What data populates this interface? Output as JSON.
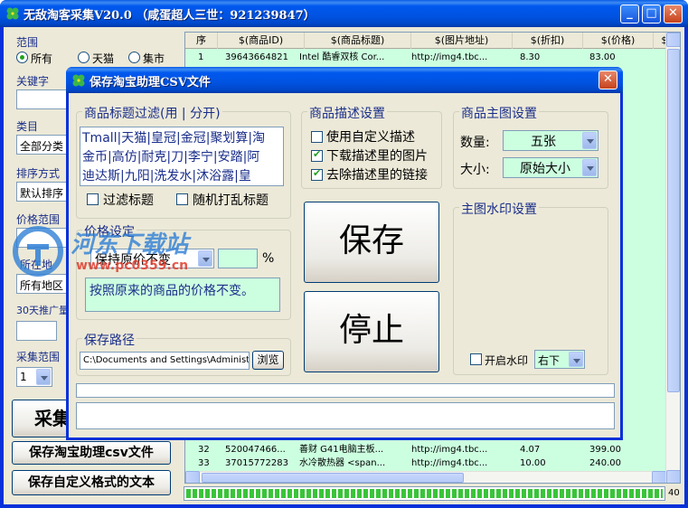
{
  "main_window": {
    "title": "无敌淘客采集V20.0 （咸蛋超人三世：921239847）",
    "min_label": "_",
    "max_label": "□",
    "close_label": "✕"
  },
  "sidebar": {
    "range_label": "范围",
    "range_options": [
      "所有",
      "天猫",
      "集市"
    ],
    "keyword_label": "关键字",
    "category_label": "类目",
    "category_value": "全部分类",
    "sort_label": "排序方式",
    "sort_value": "默认排序",
    "price_range_label": "价格范围",
    "location_label": "所在地",
    "location_value": "所有地区",
    "promo30_label": "30天推广量",
    "collect_range_label": "采集范围",
    "collect_range_value": "1",
    "collect_button": "采集",
    "save_csv_button": "保存淘宝助理csv文件",
    "save_text_button": "保存自定义格式的文本"
  },
  "grid": {
    "columns": [
      "序",
      "$(商品ID)",
      "$(商品标题)",
      "$(图片地址)",
      "$(折扣)",
      "$(价格)",
      "$(佣"
    ],
    "rows": [
      {
        "n": "1",
        "id": "39643664821",
        "title": "Intel 酷睿双核 Cor...",
        "img": "http://img4.tbc...",
        "discount": "8.30",
        "price": "83.00"
      },
      {
        "n": "32",
        "id": "520047466...",
        "title": "善财 G41电脑主板...",
        "img": "http://img4.tbc...",
        "discount": "4.07",
        "price": "399.00"
      },
      {
        "n": "33",
        "id": "37015772283",
        "title": "水冷散热器 <span...",
        "img": "http://img4.tbc...",
        "discount": "10.00",
        "price": "240.00"
      }
    ],
    "progress_count": "40",
    "progress_fraction": 1.0
  },
  "dialog": {
    "title": "保存淘宝助理CSV文件",
    "close_label": "✕",
    "title_filter_label": "商品标题过滤(用 | 分开)",
    "title_filter_text": [
      "Tmall|天猫|皇冠|金冠|聚划算|淘",
      "金币|高仿|耐克|刀|李宁|安踏|阿",
      "迪达斯|九阳|洗发水|沐浴露|皇"
    ],
    "filter_title_checkbox": "过滤标题",
    "shuffle_title_checkbox": "随机打乱标题",
    "price_setting_label": "价格设定",
    "price_mode_value": "保持原价不变",
    "price_unit": "%",
    "price_desc": "按照原来的商品的价格不变。",
    "save_path_label": "保存路径",
    "save_path_value": "C:\\Documents and Settings\\Administr",
    "browse_button": "浏览",
    "desc_settings_label": "商品描述设置",
    "desc_options": [
      {
        "label": "使用自定义描述",
        "checked": false
      },
      {
        "label": "下载描述里的图片",
        "checked": true
      },
      {
        "label": "去除描述里的链接",
        "checked": true
      }
    ],
    "save_button": "保存",
    "stop_button": "停止",
    "main_image_label": "商品主图设置",
    "count_label": "数量:",
    "count_value": "五张",
    "size_label": "大小:",
    "size_value": "原始大小",
    "watermark_label": "主图水印设置",
    "enable_watermark": "开启水印",
    "watermark_position": "右下"
  },
  "overlay_watermark": {
    "text": "河东下载站",
    "url": "www.pc0359.cn"
  },
  "colors": {
    "titlebar": "#0058ee",
    "grid_bg": "#ccffe0",
    "label_blue": "#1a2e8a",
    "progress_green": "#3ac43a"
  }
}
